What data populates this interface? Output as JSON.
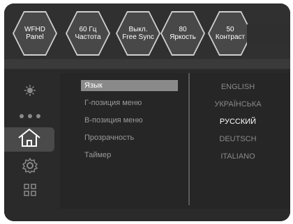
{
  "top_tiles": [
    {
      "line1": "WFHD",
      "line2": "Panel"
    },
    {
      "line1": "60 Гц",
      "line2": "Частота"
    },
    {
      "line1": "Выкл.",
      "line2": "Free Sync"
    },
    {
      "line1": "80",
      "line2": "Яркость"
    },
    {
      "line1": "50",
      "line2": "Контраст"
    }
  ],
  "sidebar": {
    "items": [
      {
        "icon": "brightness-icon"
      },
      {
        "icon": "more-dots-icon"
      },
      {
        "icon": "home-icon"
      },
      {
        "icon": "gear-icon"
      },
      {
        "icon": "grid-icon"
      }
    ]
  },
  "menu": {
    "items": [
      {
        "label": "Язык"
      },
      {
        "label": "Г-позиция меню"
      },
      {
        "label": "В-позиция меню"
      },
      {
        "label": "Прозрачность"
      },
      {
        "label": "Таймер"
      }
    ],
    "selected_index": 0
  },
  "languages": {
    "items": [
      "ENGLISH",
      "УКРАЇНСЬКА",
      "РУССКИЙ",
      "DEUTSCH",
      "ITALIANO"
    ],
    "selected_index": 2
  },
  "colors": {
    "accent": "#8a8a8a",
    "background": "#2a2a2a"
  }
}
